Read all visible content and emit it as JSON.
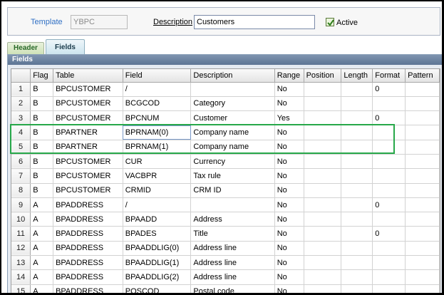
{
  "header": {
    "template_label": "Template",
    "template_value": "YBPC",
    "description_label": "Description",
    "description_value": "Customers",
    "active_label": "Active",
    "active_checked": true
  },
  "tabs": [
    {
      "label": "Header",
      "active": false
    },
    {
      "label": "Fields",
      "active": true
    }
  ],
  "fields_section": {
    "title": "Fields",
    "columns": [
      "",
      "Flag",
      "Table",
      "Field",
      "Description",
      "Range",
      "Position",
      "Length",
      "Format",
      "Pattern"
    ],
    "rows": [
      {
        "n": "1",
        "flag": "B",
        "table": "BPCUSTOMER",
        "field": "/",
        "description": "",
        "range": "No",
        "position": "",
        "length": "",
        "format": "0",
        "pattern": ""
      },
      {
        "n": "2",
        "flag": "B",
        "table": "BPCUSTOMER",
        "field": "BCGCOD",
        "description": "Category",
        "range": "No",
        "position": "",
        "length": "",
        "format": "",
        "pattern": ""
      },
      {
        "n": "3",
        "flag": "B",
        "table": "BPCUSTOMER",
        "field": "BPCNUM",
        "description": "Customer",
        "range": "Yes",
        "position": "",
        "length": "",
        "format": "0",
        "pattern": ""
      },
      {
        "n": "4",
        "flag": "B",
        "table": "BPARTNER",
        "field": "BPRNAM(0)",
        "description": "Company name",
        "range": "No",
        "position": "",
        "length": "",
        "format": "",
        "pattern": ""
      },
      {
        "n": "5",
        "flag": "B",
        "table": "BPARTNER",
        "field": "BPRNAM(1)",
        "description": "Company name",
        "range": "No",
        "position": "",
        "length": "",
        "format": "",
        "pattern": ""
      },
      {
        "n": "6",
        "flag": "B",
        "table": "BPCUSTOMER",
        "field": "CUR",
        "description": "Currency",
        "range": "No",
        "position": "",
        "length": "",
        "format": "",
        "pattern": ""
      },
      {
        "n": "7",
        "flag": "B",
        "table": "BPCUSTOMER",
        "field": "VACBPR",
        "description": "Tax rule",
        "range": "No",
        "position": "",
        "length": "",
        "format": "",
        "pattern": ""
      },
      {
        "n": "8",
        "flag": "B",
        "table": "BPCUSTOMER",
        "field": "CRMID",
        "description": "CRM ID",
        "range": "No",
        "position": "",
        "length": "",
        "format": "",
        "pattern": ""
      },
      {
        "n": "9",
        "flag": "A",
        "table": "BPADDRESS",
        "field": "/",
        "description": "",
        "range": "No",
        "position": "",
        "length": "",
        "format": "0",
        "pattern": ""
      },
      {
        "n": "10",
        "flag": "A",
        "table": "BPADDRESS",
        "field": "BPAADD",
        "description": "Address",
        "range": "No",
        "position": "",
        "length": "",
        "format": "",
        "pattern": ""
      },
      {
        "n": "11",
        "flag": "A",
        "table": "BPADDRESS",
        "field": "BPADES",
        "description": "Title",
        "range": "No",
        "position": "",
        "length": "",
        "format": "0",
        "pattern": ""
      },
      {
        "n": "12",
        "flag": "A",
        "table": "BPADDRESS",
        "field": "BPAADDLIG(0)",
        "description": "Address line",
        "range": "No",
        "position": "",
        "length": "",
        "format": "",
        "pattern": ""
      },
      {
        "n": "13",
        "flag": "A",
        "table": "BPADDRESS",
        "field": "BPAADDLIG(1)",
        "description": "Address line",
        "range": "No",
        "position": "",
        "length": "",
        "format": "",
        "pattern": ""
      },
      {
        "n": "14",
        "flag": "A",
        "table": "BPADDRESS",
        "field": "BPAADDLIG(2)",
        "description": "Address line",
        "range": "No",
        "position": "",
        "length": "",
        "format": "",
        "pattern": ""
      },
      {
        "n": "15",
        "flag": "A",
        "table": "BPADDRESS",
        "field": "POSCOD",
        "description": "Postal code",
        "range": "No",
        "position": "",
        "length": "",
        "format": "",
        "pattern": ""
      }
    ]
  },
  "colors": {
    "highlight_box": "#27a84a",
    "template_label": "#2f6fc4",
    "section_title_bg": "#5d7594"
  },
  "icons": {
    "active_checkbox": "checkmark-icon"
  }
}
